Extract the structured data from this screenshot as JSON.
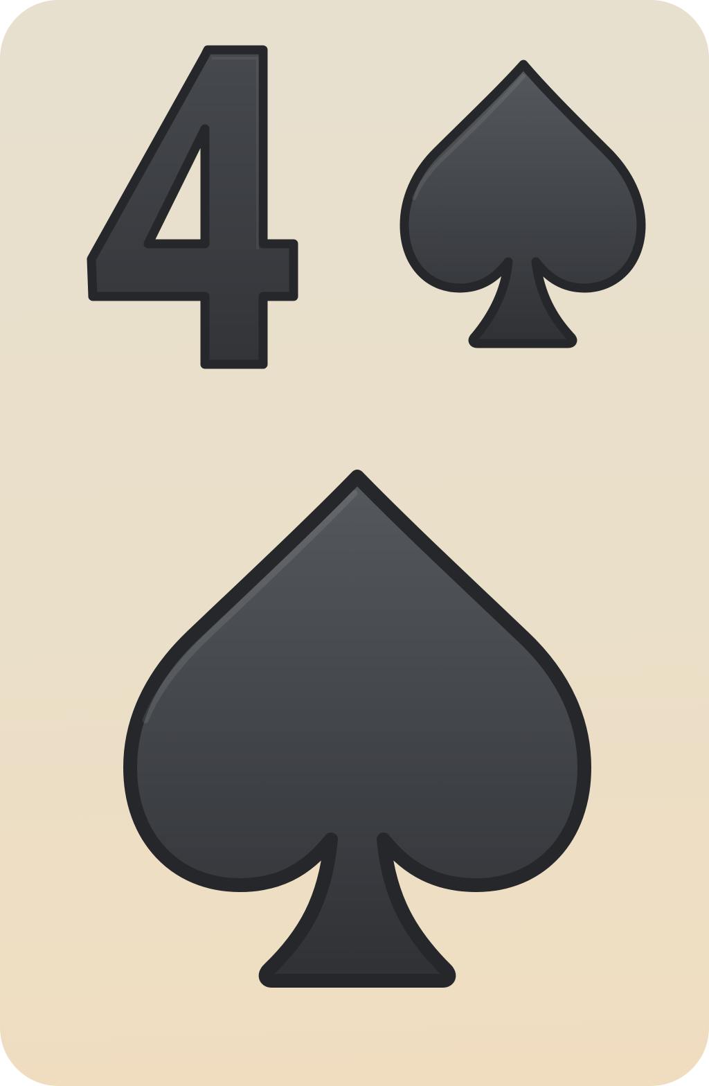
{
  "card": {
    "rank": "4",
    "suit": "spades",
    "suit_icon": "spade-icon",
    "colors": {
      "background_top": "#e7e0cf",
      "background_bottom": "#f0ddc0",
      "ink_fill_top": "#55595e",
      "ink_fill_bottom": "#2f3135",
      "ink_outline": "#25272b"
    }
  }
}
